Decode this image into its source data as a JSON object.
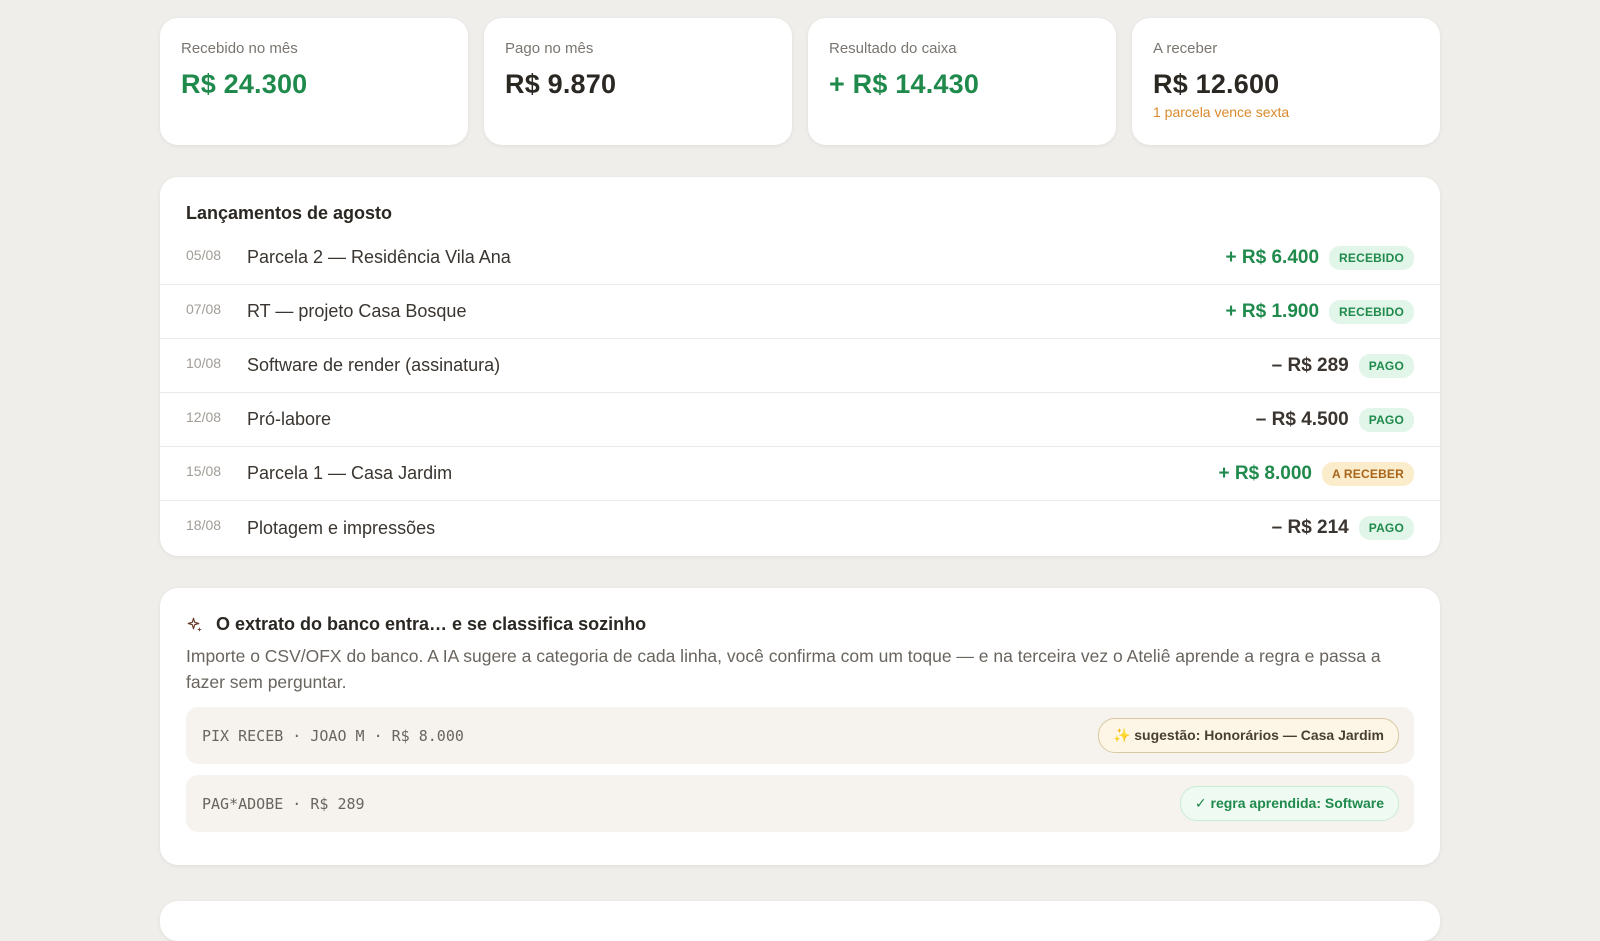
{
  "stats": [
    {
      "label": "Recebido no mês",
      "value": "R$ 24.300",
      "tone": "green",
      "note": ""
    },
    {
      "label": "Pago no mês",
      "value": "R$ 9.870",
      "tone": "dark",
      "note": ""
    },
    {
      "label": "Resultado do caixa",
      "value": "+ R$ 14.430",
      "tone": "green",
      "note": ""
    },
    {
      "label": "A receber",
      "value": "R$ 12.600",
      "tone": "dark",
      "note": "1 parcela vence sexta"
    }
  ],
  "entries": {
    "title": "Lançamentos de agosto",
    "rows": [
      {
        "date": "05/08",
        "desc": "Parcela 2 — Residência Vila Ana",
        "amount": "+ R$ 6.400",
        "dir": "in",
        "status": "RECEBIDO",
        "status_kind": "ok"
      },
      {
        "date": "07/08",
        "desc": "RT — projeto Casa Bosque",
        "amount": "+ R$ 1.900",
        "dir": "in",
        "status": "RECEBIDO",
        "status_kind": "ok"
      },
      {
        "date": "10/08",
        "desc": "Software de render (assinatura)",
        "amount": "– R$ 289",
        "dir": "out",
        "status": "PAGO",
        "status_kind": "ok"
      },
      {
        "date": "12/08",
        "desc": "Pró-labore",
        "amount": "– R$ 4.500",
        "dir": "out",
        "status": "PAGO",
        "status_kind": "ok"
      },
      {
        "date": "15/08",
        "desc": "Parcela 1 — Casa Jardim",
        "amount": "+ R$ 8.000",
        "dir": "in",
        "status": "A RECEBER",
        "status_kind": "pending"
      },
      {
        "date": "18/08",
        "desc": "Plotagem e impressões",
        "amount": "– R$ 214",
        "dir": "out",
        "status": "PAGO",
        "status_kind": "ok"
      }
    ]
  },
  "import": {
    "icon": "sparkle-icon",
    "title": "O extrato do banco entra… e se classifica sozinho",
    "text": "Importe o CSV/OFX do banco. A IA sugere a categoria de cada linha, você confirma com um toque — e na terceira vez o Ateliê aprende a regra e passa a fazer sem perguntar.",
    "rows": [
      {
        "line": "PIX RECEB · JOAO M · R$ 8.000",
        "chip": "✨ sugestão: Honorários — Casa Jardim",
        "chip_kind": "suggest"
      },
      {
        "line": "PAG*ADOBE · R$ 289",
        "chip": "✓ regra aprendida: Software",
        "chip_kind": "learned"
      }
    ]
  },
  "colors": {
    "green": "#1f8a4c",
    "amber": "#d98a2b",
    "background": "#f0eeeb"
  }
}
